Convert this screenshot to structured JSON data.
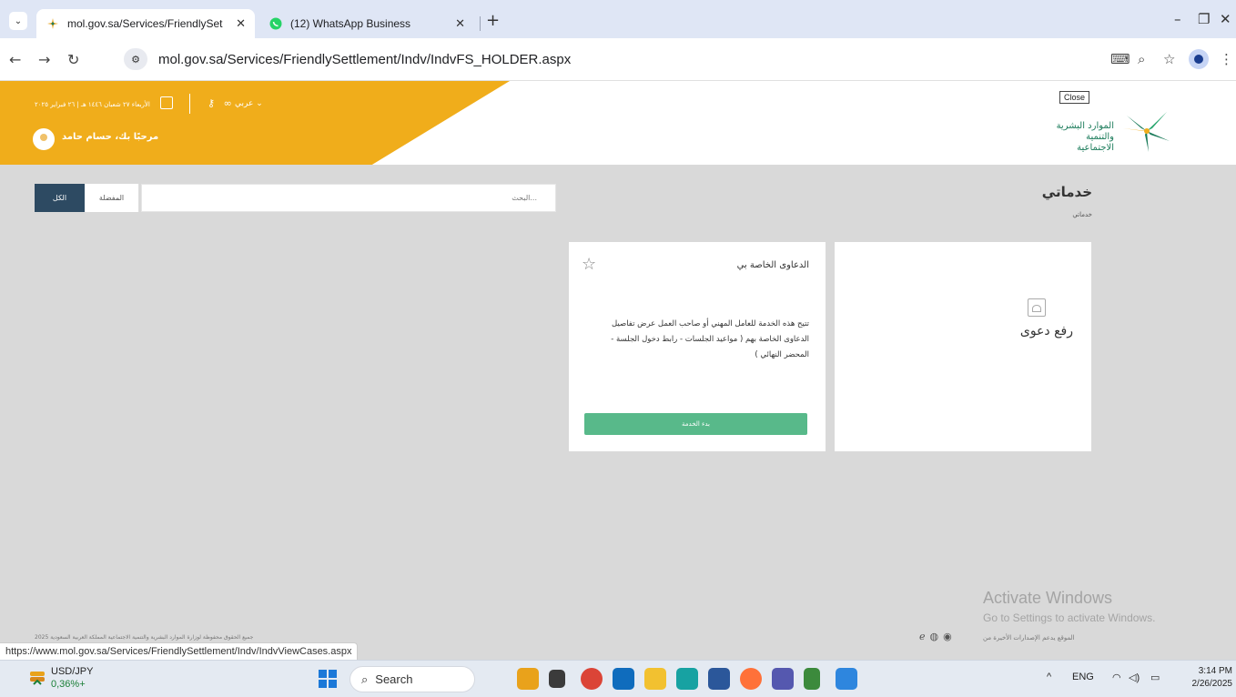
{
  "browser": {
    "tabs": [
      {
        "title": "mol.gov.sa/Services/FriendlySet",
        "active": true
      },
      {
        "title": "(12) WhatsApp Business",
        "active": false
      }
    ],
    "new_tab": "+",
    "url": "mol.gov.sa/Services/FriendlySettlement/Indv/IndvFS_HOLDER.aspx",
    "status_url": "https://www.mol.gov.sa/Services/FriendlySettlement/Indv/IndvViewCases.aspx",
    "window_controls": {
      "minimize": "–",
      "restore": "❐",
      "close": "✕"
    }
  },
  "header": {
    "date_text": "الأربعاء ٢٧ شعبان ١٤٤٦ هـ | ٢٦ فبراير ٢٠٢٥",
    "language": "عربي ⌄",
    "greeting": "مرحبًا بك، حسام حامد",
    "close_tooltip": "Close",
    "logo_line1": "الموارد البشرية",
    "logo_line2": "والتنمية الاجتماعية"
  },
  "main": {
    "title": "خدماتي",
    "breadcrumb": "خدماتي",
    "filters": {
      "all": "الكل",
      "favorites": "المفضلة"
    },
    "search_placeholder": "البحث...",
    "cards": {
      "cases": {
        "title": "الدعاوى الخاصة بي",
        "description": "تتيح هذه الخدمة للعامل المهني أو صاحب العمل عرض تفاصيل الدعاوى الخاصة بهم ( مواعيد الجلسات - رابط دخول الجلسة - المحضر النهائي )",
        "button": "بدء الخدمة",
        "star": "☆"
      },
      "file_case": {
        "label": "رفع دعوى"
      }
    }
  },
  "footer": {
    "copyright": "جميع الحقوق محفوظة لوزارة الموارد البشرية والتنمية الاجتماعية المملكة العربية السعودية 2025",
    "browsers_text": "الموقع يدعم الإصدارات الأخيرة من"
  },
  "activation": {
    "line1": "Activate Windows",
    "line2": "Go to Settings to activate Windows."
  },
  "taskbar": {
    "ticker_name": "USD/JPY",
    "ticker_change": "0,36%+",
    "search_label": "Search",
    "tray_lang": "ENG",
    "time": "3:14 PM",
    "date": "2/26/2025"
  },
  "colors": {
    "header_yellow": "#f0ad1b",
    "button_green": "#58b98a",
    "filter_active": "#2d4a62",
    "page_bg": "#d9d9d9"
  }
}
